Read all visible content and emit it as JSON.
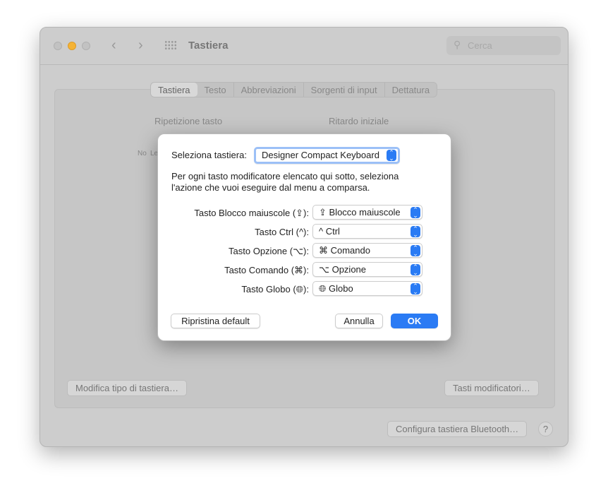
{
  "window": {
    "title": "Tastiera",
    "search_placeholder": "Cerca"
  },
  "tabs": [
    "Tastiera",
    "Testo",
    "Abbreviazioni",
    "Sorgenti di input",
    "Dettatura"
  ],
  "labels": {
    "key_repeat": "Ripetizione tasto",
    "initial_delay": "Ritardo iniziale",
    "slider_left": "No",
    "slider_left2": "Le"
  },
  "buttons": {
    "change_type": "Modifica tipo di tastiera…",
    "modifier_keys": "Tasti modificatori…",
    "bluetooth": "Configura tastiera Bluetooth…",
    "help": "?"
  },
  "dialog": {
    "select_label": "Seleziona tastiera:",
    "keyboard": "Designer Compact Keyboard",
    "description": "Per ogni tasto modificatore elencato qui sotto, seleziona l'azione che vuoi eseguire dal menu a comparsa.",
    "rows": [
      {
        "label": "Tasto Blocco maiuscole (⇪):",
        "value": "⇪ Blocco maiuscole"
      },
      {
        "label": "Tasto Ctrl (^):",
        "value": "^ Ctrl"
      },
      {
        "label": "Tasto Opzione (⌥):",
        "value": "⌘ Comando"
      },
      {
        "label": "Tasto Comando (⌘):",
        "value": "⌥ Opzione"
      },
      {
        "label": "Tasto Globo (🌐︎):",
        "value": "🌐︎ Globo"
      }
    ],
    "restore": "Ripristina default",
    "cancel": "Annulla",
    "ok": "OK"
  }
}
